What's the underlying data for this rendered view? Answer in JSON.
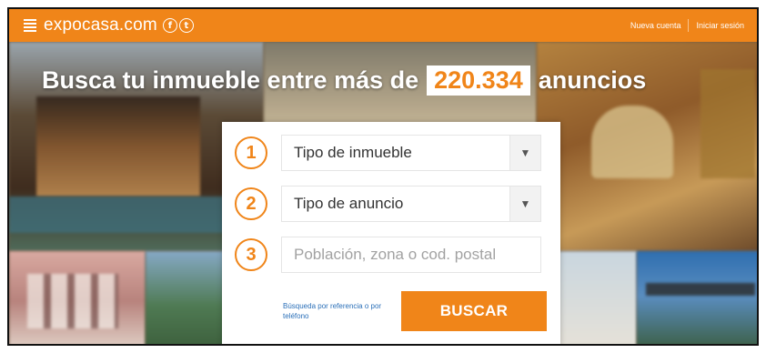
{
  "header": {
    "brand": "expocasa.com",
    "social": [
      {
        "icon": "facebook-icon",
        "glyph": "f"
      },
      {
        "icon": "twitter-icon",
        "glyph": "t"
      }
    ],
    "new_account": "Nueva cuenta",
    "login": "Iniciar sesión"
  },
  "hero": {
    "headline_before": "Busca tu inmueble entre más de",
    "count": "220.334",
    "headline_after": "anuncios"
  },
  "search": {
    "steps": [
      {
        "number": "1",
        "label": "Tipo de inmueble"
      },
      {
        "number": "2",
        "label": "Tipo de anuncio"
      },
      {
        "number": "3",
        "placeholder": "Población, zona o cod. postal"
      }
    ],
    "reference_link": "Búsqueda por referencia o por teléfono",
    "button": "BUSCAR"
  },
  "colors": {
    "brand_orange": "#f08519",
    "link_blue": "#2a6fb8"
  }
}
